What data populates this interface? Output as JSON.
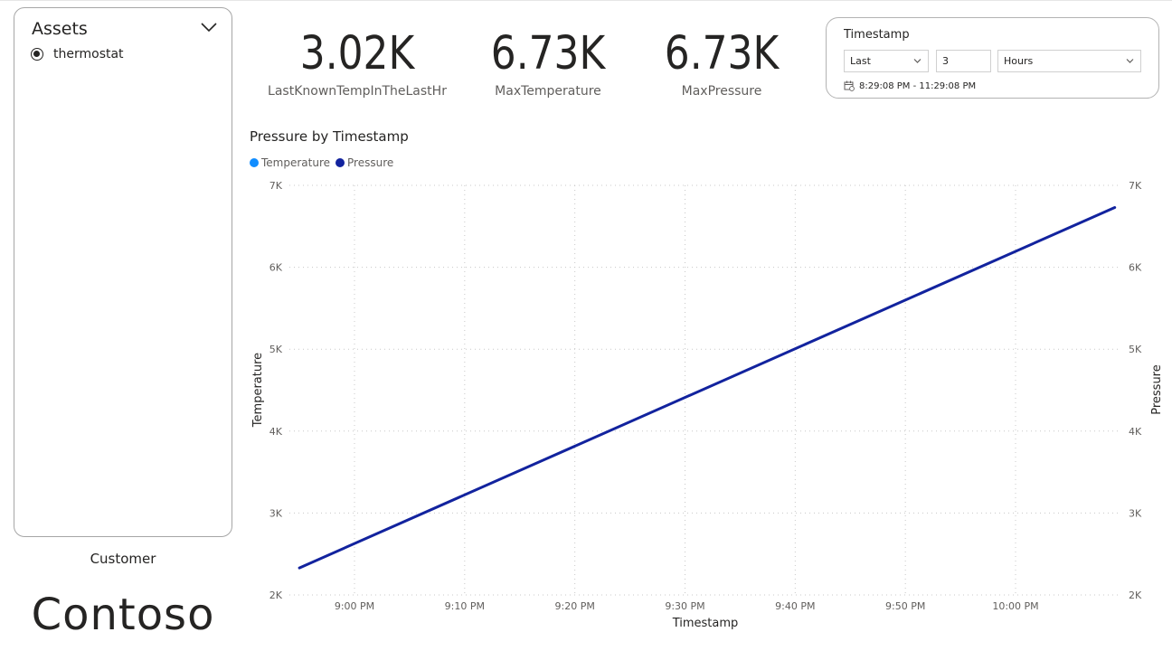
{
  "slicer": {
    "title": "Assets",
    "options": [
      {
        "label": "thermostat",
        "selected": true
      }
    ]
  },
  "customer": {
    "label": "Customer",
    "name": "Contoso"
  },
  "kpis": [
    {
      "value": "3.02K",
      "label": "LastKnownTempInTheLastHr"
    },
    {
      "value": "6.73K",
      "label": "MaxTemperature"
    },
    {
      "value": "6.73K",
      "label": "MaxPressure"
    }
  ],
  "timestamp_filter": {
    "title": "Timestamp",
    "mode": "Last",
    "count": "3",
    "unit": "Hours",
    "range": "8:29:08 PM - 11:29:08 PM"
  },
  "colors": {
    "temperature": "#118dff",
    "pressure": "#12239e",
    "grid": "#c8c8c8",
    "text": "#252423",
    "axis_text": "#605e5c"
  },
  "chart_data": {
    "type": "line",
    "title": "Pressure by Timestamp",
    "xlabel": "Timestamp",
    "ylabel": "Temperature",
    "ylabel_right": "Pressure",
    "legend_position": "top-left",
    "grid": true,
    "ylim": [
      2000,
      7000
    ],
    "y_ticks": [
      "2K",
      "3K",
      "4K",
      "5K",
      "6K",
      "7K"
    ],
    "x_tick_labels": [
      "9:00 PM",
      "9:10 PM",
      "9:20 PM",
      "9:30 PM",
      "9:40 PM",
      "9:50 PM",
      "10:00 PM"
    ],
    "xlim": [
      "8:55 PM",
      "10:09 PM"
    ],
    "series": [
      {
        "name": "Temperature",
        "x": [],
        "y": []
      },
      {
        "name": "Pressure",
        "x": [
          "8:55 PM",
          "10:09 PM"
        ],
        "y": [
          2330,
          6730
        ]
      }
    ]
  }
}
